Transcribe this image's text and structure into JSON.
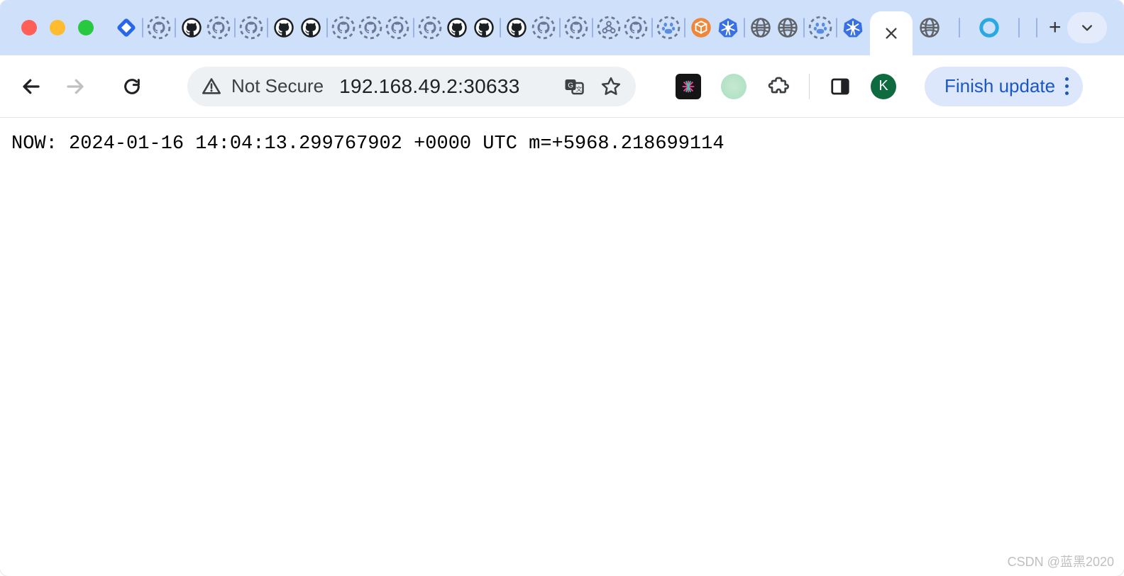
{
  "window": {
    "traffic_lights": [
      "close",
      "minimize",
      "maximize"
    ]
  },
  "tab_strip": {
    "favicons": [
      {
        "name": "jira-icon",
        "color": "#2868e8"
      },
      {
        "name": "github-dashed-icon"
      },
      {
        "name": "github-icon"
      },
      {
        "name": "github-dashed-icon"
      },
      {
        "name": "github-dashed-icon"
      },
      {
        "name": "github-icon"
      },
      {
        "name": "github-icon"
      },
      {
        "name": "github-dashed-icon"
      },
      {
        "name": "github-dashed-icon"
      },
      {
        "name": "github-dashed-icon"
      },
      {
        "name": "github-dashed-icon"
      },
      {
        "name": "github-icon"
      },
      {
        "name": "github-icon"
      },
      {
        "name": "github-icon"
      },
      {
        "name": "github-dashed-icon"
      },
      {
        "name": "github-dashed-icon"
      },
      {
        "name": "tangle-dashed-icon"
      },
      {
        "name": "github-dashed-icon"
      },
      {
        "name": "baidu-dashed-icon"
      },
      {
        "name": "cube-orange-icon",
        "color": "#f08638"
      },
      {
        "name": "kubernetes-icon",
        "color": "#3970e4"
      },
      {
        "name": "globe-icon"
      },
      {
        "name": "globe-icon"
      },
      {
        "name": "baidu-dashed-icon"
      },
      {
        "name": "kubernetes-icon",
        "color": "#3970e4"
      }
    ],
    "active_tab_close": "×",
    "post_tabs": [
      {
        "name": "globe-icon"
      },
      {
        "name": "circle-blue-icon",
        "color": "#29a9e1"
      }
    ],
    "new_tab_label": "+"
  },
  "toolbar": {
    "back_enabled": true,
    "forward_enabled": false,
    "security_label": "Not Secure",
    "url": "192.168.49.2:30633",
    "translate_label": "Translate",
    "star_label": "Bookmark",
    "extensions": [
      {
        "name": "slack-icon",
        "bg": "#151515",
        "fg": "#ff3ea5"
      },
      {
        "name": "mint-circle-icon",
        "bg": "#c7e9d1"
      }
    ],
    "puzzle_label": "Extensions",
    "side_panel_label": "Side panel",
    "profile_initial": "K",
    "update_label": "Finish update"
  },
  "page": {
    "body_text": "NOW: 2024-01-16 14:04:13.299767902 +0000 UTC m=+5968.218699114"
  },
  "watermark": "CSDN @蓝黑2020"
}
